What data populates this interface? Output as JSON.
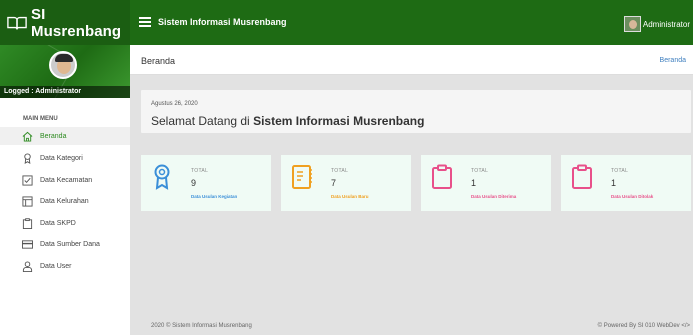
{
  "brand": {
    "title": "SI Musrenbang"
  },
  "header": {
    "app_title": "Sistem Informasi Musrenbang",
    "user": "Administrator"
  },
  "sidebar": {
    "logged_label": "Logged : Administrator",
    "menu_header": "MAIN MENU",
    "items": [
      {
        "label": "Beranda",
        "icon": "home-icon",
        "active": true
      },
      {
        "label": "Data Kategori",
        "icon": "award-icon"
      },
      {
        "label": "Data Kecamatan",
        "icon": "check-square-icon"
      },
      {
        "label": "Data Kelurahan",
        "icon": "layout-icon"
      },
      {
        "label": "Data SKPD",
        "icon": "clipboard-icon"
      },
      {
        "label": "Data Sumber Dana",
        "icon": "credit-card-icon"
      },
      {
        "label": "Data User",
        "icon": "user-icon"
      }
    ]
  },
  "page": {
    "title": "Beranda",
    "breadcrumb": "Beranda"
  },
  "welcome": {
    "date": "Agustus 26, 2020",
    "title": "Selamat Datang di Sistem Informasi Musrenbang",
    "title_bold": "Sistem Informasi Musrenbang"
  },
  "cards": [
    {
      "caption": "TOTAL",
      "value": "9",
      "link": "Data Usulan Kegiatan",
      "color": "#3b8fd8",
      "icon": "award-icon"
    },
    {
      "caption": "TOTAL",
      "value": "7",
      "link": "Data Usulan Baru",
      "color": "#f0a020",
      "icon": "notebook-icon"
    },
    {
      "caption": "TOTAL",
      "value": "1",
      "link": "Data Usulan Diterima",
      "color": "#e8508a",
      "icon": "clipboard-icon"
    },
    {
      "caption": "TOTAL",
      "value": "1",
      "link": "Data Usulan Ditolak",
      "color": "#e8508a",
      "icon": "clipboard-icon"
    }
  ],
  "footer": {
    "left": "2020 © Sistem Informasi Musrenbang",
    "right": "© Powered By SI 010 WebDev </>"
  }
}
